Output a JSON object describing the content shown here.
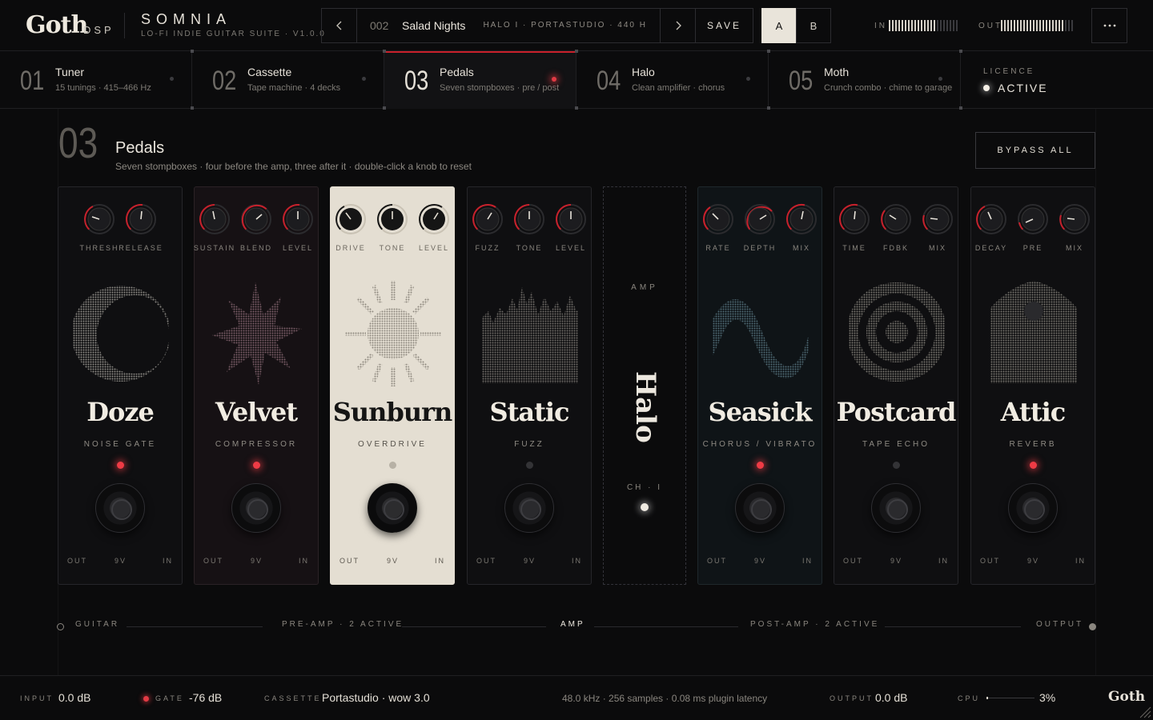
{
  "brand": {
    "logo": "Goth",
    "logo_sub": "DSP",
    "product": "SOMNIA",
    "product_sub": "LO-FI INDIE GUITAR SUITE · V1.0.0"
  },
  "preset": {
    "number": "002",
    "name": "Salad Nights",
    "chain": "HALO I · PORTASTUDIO · 440 H",
    "prev_icon": "chevron-left-icon",
    "next_icon": "chevron-right-icon",
    "save_label": "SAVE"
  },
  "ab": {
    "a": "A",
    "b": "B",
    "selected": "A"
  },
  "meters": {
    "in_label": "IN",
    "out_label": "OUT"
  },
  "menu_icon": "more-horizontal-icon",
  "tabs": [
    {
      "num": "01",
      "title": "Tuner",
      "sub": "15 tunings · 415–466 Hz"
    },
    {
      "num": "02",
      "title": "Cassette",
      "sub": "Tape machine · 4 decks"
    },
    {
      "num": "03",
      "title": "Pedals",
      "sub": "Seven stompboxes · pre / post",
      "active": true
    },
    {
      "num": "04",
      "title": "Halo",
      "sub": "Clean amplifier · chorus"
    },
    {
      "num": "05",
      "title": "Moth",
      "sub": "Crunch combo · chime to garage"
    }
  ],
  "licence": {
    "label": "LICENCE",
    "value": "ACTIVE"
  },
  "section": {
    "num": "03",
    "title": "Pedals",
    "sub": "Seven stompboxes · four before the amp, three after it · double-click a knob to reset",
    "bypass_label": "BYPASS ALL"
  },
  "pedals": [
    {
      "name": "Doze",
      "type": "NOISE GATE",
      "knobs": [
        "THRESH",
        "RELEASE"
      ],
      "led_on": true,
      "jacks": [
        "OUT",
        "9V",
        "IN"
      ]
    },
    {
      "name": "Velvet",
      "type": "COMPRESSOR",
      "knobs": [
        "SUSTAIN",
        "BLEND",
        "LEVEL"
      ],
      "led_on": true,
      "jacks": [
        "OUT",
        "9V",
        "IN"
      ]
    },
    {
      "name": "Sunburn",
      "type": "OVERDRIVE",
      "knobs": [
        "DRIVE",
        "TONE",
        "LEVEL"
      ],
      "led_on": false,
      "jacks": [
        "OUT",
        "9V",
        "IN"
      ]
    },
    {
      "name": "Static",
      "type": "FUZZ",
      "knobs": [
        "FUZZ",
        "TONE",
        "LEVEL"
      ],
      "led_on": false,
      "jacks": [
        "OUT",
        "9V",
        "IN"
      ]
    },
    {
      "name": "Seasick",
      "type": "CHORUS / VIBRATO",
      "knobs": [
        "RATE",
        "DEPTH",
        "MIX"
      ],
      "led_on": true,
      "jacks": [
        "OUT",
        "9V",
        "IN"
      ]
    },
    {
      "name": "Postcard",
      "type": "TAPE ECHO",
      "knobs": [
        "TIME",
        "FDBK",
        "MIX"
      ],
      "led_on": false,
      "jacks": [
        "OUT",
        "9V",
        "IN"
      ]
    },
    {
      "name": "Attic",
      "type": "REVERB",
      "knobs": [
        "DECAY",
        "PRE",
        "MIX"
      ],
      "led_on": true,
      "jacks": [
        "OUT",
        "9V",
        "IN"
      ]
    }
  ],
  "amp": {
    "label": "AMP",
    "name": "Halo",
    "channel": "CH · I"
  },
  "signal_chain": {
    "guitar": "GUITAR",
    "pre": "PRE-AMP · 2 ACTIVE",
    "amp": "AMP",
    "post": "POST-AMP · 2 ACTIVE",
    "output": "OUTPUT"
  },
  "footer": {
    "input_label": "INPUT",
    "input_value": "0.0 dB",
    "gate_label": "GATE",
    "gate_value": "-76 dB",
    "cassette_label": "CASSETTE",
    "cassette_value": "Portastudio · wow 3.0",
    "info": "48.0 kHz · 256 samples · 0.08 ms plugin latency",
    "output_label": "OUTPUT",
    "output_value": "0.0 dB",
    "cpu_label": "CPU",
    "cpu_value": "3%",
    "cpu_fraction": 0.03,
    "logo": "Goth"
  },
  "colors": {
    "accent": "#c8202b",
    "led": "#ee3b45",
    "cream": "#e4ded2",
    "bg": "#0b0b0c"
  }
}
